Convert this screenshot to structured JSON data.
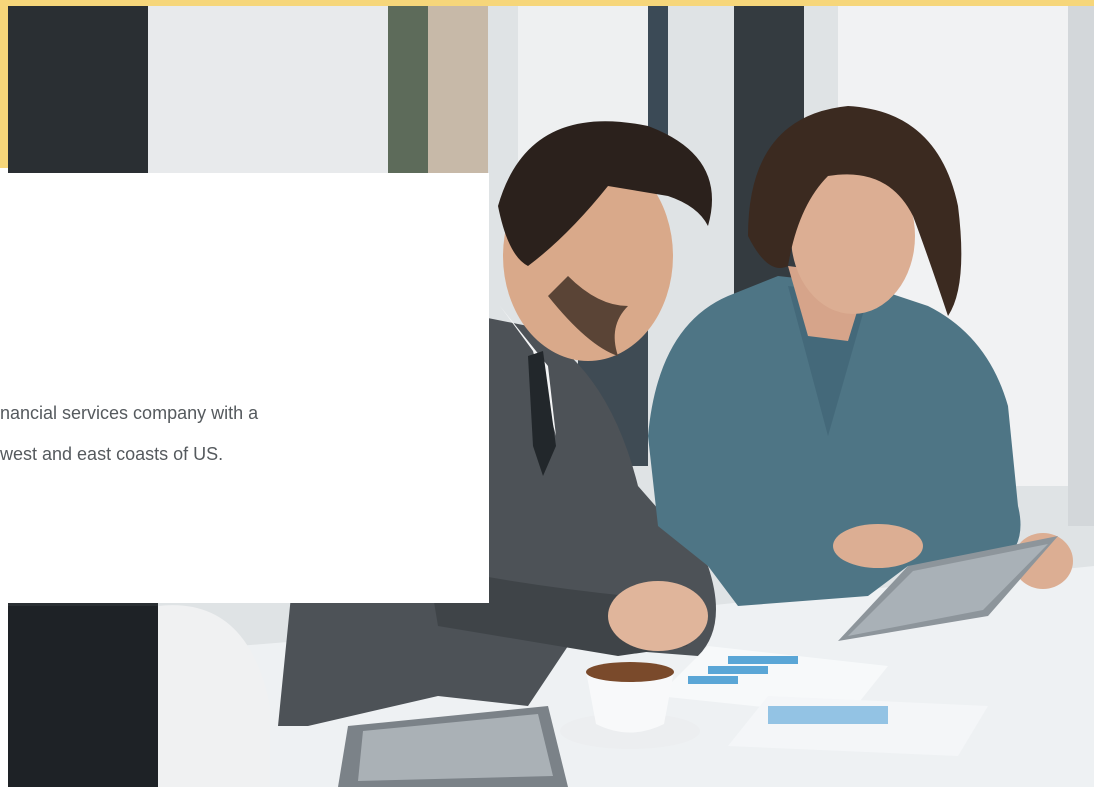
{
  "card": {
    "lines": [
      "nancial services company with a",
      " west and east coasts of US."
    ]
  },
  "colors": {
    "accent": "#f6d67a",
    "card_background": "#ffffff",
    "text": "#555a5e"
  }
}
